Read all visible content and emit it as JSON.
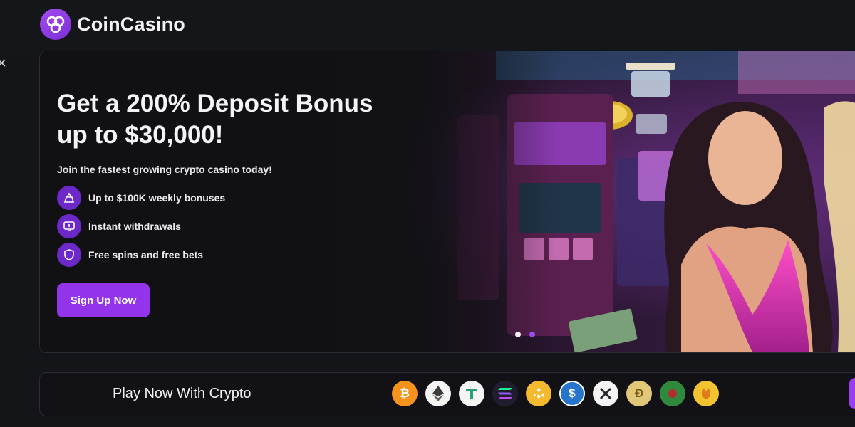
{
  "brand": {
    "name": "CoinCasino"
  },
  "hero": {
    "headline_pre": "Get a ",
    "headline_bold": "200% Deposit Bonus",
    "headline_line2_pre": "up to ",
    "headline_line2_bold": "$30,000!",
    "tagline": "Join the fastest growing crypto casino today!",
    "features": [
      {
        "icon": "bonus-icon",
        "label": "Up to $100K weekly bonuses"
      },
      {
        "icon": "withdraw-icon",
        "label": "Instant withdrawals"
      },
      {
        "icon": "shield-icon",
        "label": "Free spins and free bets"
      }
    ],
    "cta_label": "Sign Up Now",
    "carousel": {
      "total": 2,
      "active": 1
    }
  },
  "close_glyph": "×",
  "crypto_bar": {
    "title": "Play Now With Crypto",
    "coins": [
      {
        "name": "bitcoin-icon",
        "glyph": "₿",
        "color": "#f7931a"
      },
      {
        "name": "ethereum-icon",
        "glyph": "◆",
        "color": "#ffffff"
      },
      {
        "name": "tether-icon",
        "glyph": "T",
        "color": "#ffffff"
      },
      {
        "name": "solana-icon",
        "glyph": "≡",
        "color": "#9945ff"
      },
      {
        "name": "bnb-icon",
        "glyph": "◈",
        "color": "#f3ba2f"
      },
      {
        "name": "usdc-icon",
        "glyph": "$",
        "color": "#2775ca"
      },
      {
        "name": "xrp-icon",
        "glyph": "✕",
        "color": "#ffffff"
      },
      {
        "name": "dogecoin-icon",
        "glyph": "Ð",
        "color": "#e1c878"
      },
      {
        "name": "pepe-coin-icon",
        "glyph": "●",
        "color": "#2f8a3d"
      },
      {
        "name": "shiba-icon",
        "glyph": "●",
        "color": "#f2c230"
      }
    ]
  },
  "colors": {
    "accent": "#9334ea",
    "background": "#141518"
  }
}
